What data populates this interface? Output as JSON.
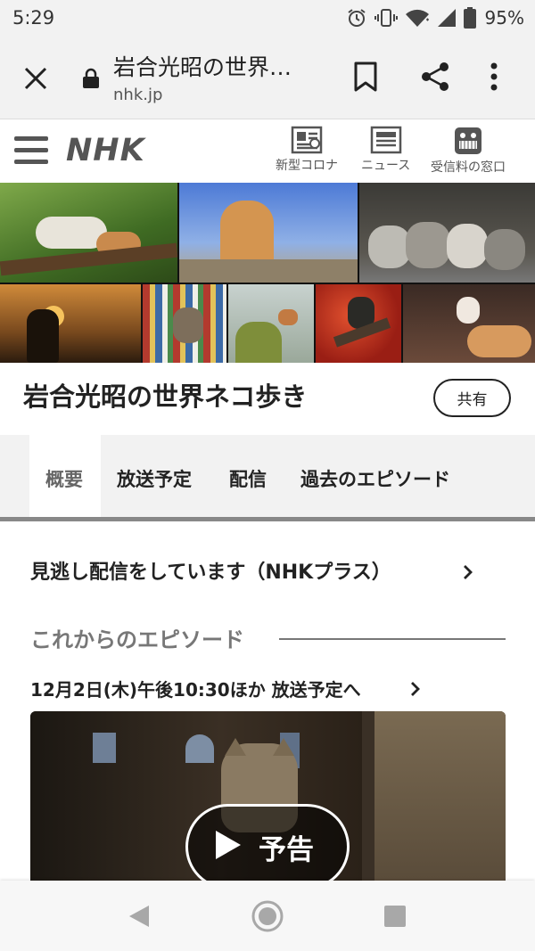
{
  "status_bar": {
    "time": "5:29",
    "battery_percent": "95%",
    "icons": [
      "alarm-icon",
      "vibrate-icon",
      "wifi-icon",
      "signal-icon",
      "battery-icon"
    ]
  },
  "browser": {
    "page_title": "岩合光昭の世界…",
    "domain": "nhk.jp",
    "icons": [
      "close-icon",
      "lock-icon",
      "bookmark-icon",
      "share-icon",
      "more-vert-icon"
    ]
  },
  "site_header": {
    "logo": "NHK",
    "links": [
      {
        "label": "新型コロナ",
        "icon": "covid-news-icon"
      },
      {
        "label": "ニュース",
        "icon": "news-icon"
      },
      {
        "label": "受信料の窓口",
        "icon": "domo-kun-icon"
      }
    ]
  },
  "program": {
    "title": "岩合光昭の世界ネコ歩き",
    "share_label": "共有"
  },
  "tabs": [
    {
      "label": "概要",
      "active": true
    },
    {
      "label": "放送予定",
      "active": false
    },
    {
      "label": "配信",
      "active": false
    },
    {
      "label": "過去のエピソード",
      "active": false
    }
  ],
  "content": {
    "stream_link": "見逃し配信をしています（NHKプラス）",
    "upcoming_heading": "これからのエピソード",
    "episode_link": "12月2日(木)午後10:30ほか  放送予定へ",
    "trailer_label": "予告"
  },
  "colors": {
    "accent_gray": "#888888",
    "tab_bg": "#f2f2f2",
    "text": "#222222"
  }
}
